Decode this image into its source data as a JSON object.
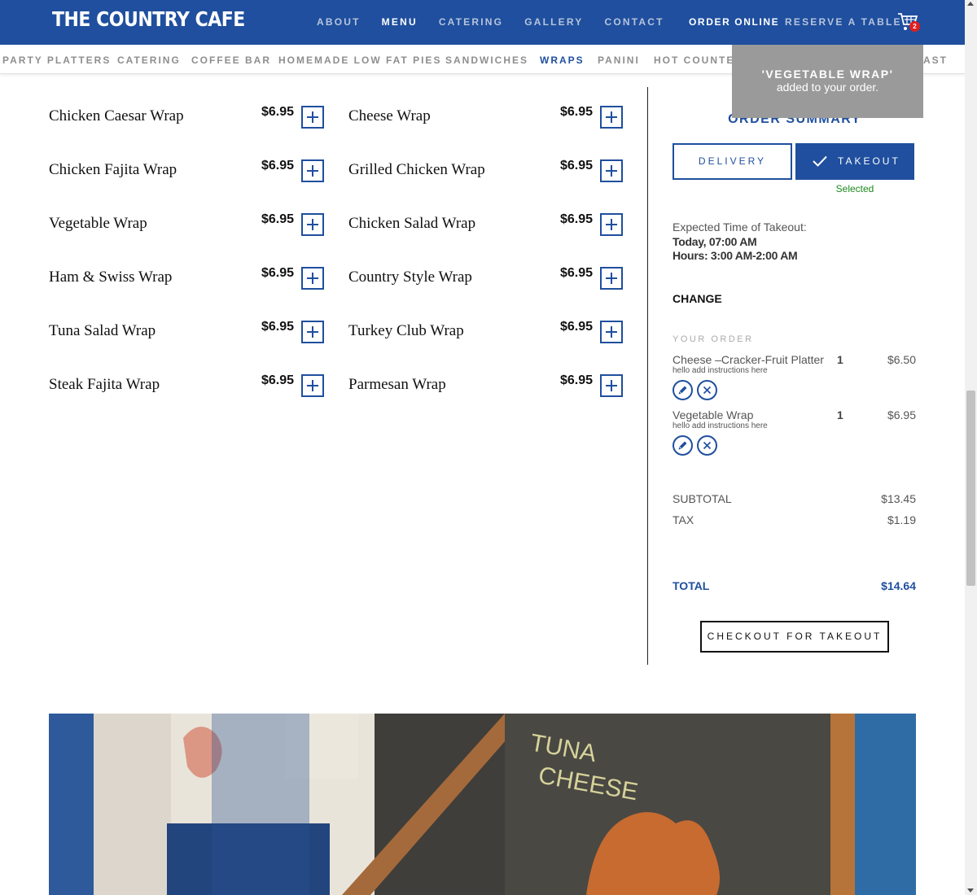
{
  "header": {
    "logo_text": "THE COUNTRY CAFE",
    "nav": [
      "ABOUT",
      "MENU",
      "CATERING",
      "GALLERY",
      "CONTACT"
    ],
    "active_nav": "MENU",
    "order_online": "ORDER ONLINE",
    "reserve": "RESERVE A TABLE",
    "cart_count": "2",
    "brand_color": "#1f4f9e"
  },
  "subnav": {
    "items": [
      "PARTY PLATTERS",
      "CATERING",
      "COFFEE BAR",
      "HOMEMADE LOW FAT PIES",
      "SANDWICHES",
      "WRAPS",
      "PANINI",
      "HOT COUNTER",
      "AST"
    ],
    "active": "WRAPS"
  },
  "menu": {
    "left": [
      {
        "name": "Chicken Caesar Wrap",
        "price": "$6.95"
      },
      {
        "name": "Chicken Fajita Wrap",
        "price": "$6.95"
      },
      {
        "name": "Vegetable Wrap",
        "price": "$6.95"
      },
      {
        "name": "Ham & Swiss Wrap",
        "price": "$6.95"
      },
      {
        "name": "Tuna Salad Wrap",
        "price": "$6.95"
      },
      {
        "name": "Steak Fajita Wrap",
        "price": "$6.95"
      }
    ],
    "right": [
      {
        "name": "Cheese Wrap",
        "price": "$6.95"
      },
      {
        "name": "Grilled Chicken Wrap",
        "price": "$6.95"
      },
      {
        "name": "Chicken Salad Wrap",
        "price": "$6.95"
      },
      {
        "name": "Country Style Wrap",
        "price": "$6.95"
      },
      {
        "name": "Turkey Club Wrap",
        "price": "$6.95"
      },
      {
        "name": "Parmesan Wrap",
        "price": "$6.95"
      }
    ]
  },
  "toast": {
    "title": "'VEGETABLE WRAP'",
    "subtitle": "added to your order."
  },
  "summary": {
    "title": "ORDER SUMMARY",
    "delivery": "DELIVERY",
    "takeout": "TAKEOUT",
    "selected": "Selected",
    "expected_label": "Expected Time of Takeout:",
    "expected_time": "Today, 07:00 AM",
    "hours": "Hours: 3:00 AM-2:00 AM",
    "change": "CHANGE",
    "your_order": "YOUR ORDER",
    "lines": [
      {
        "name": "Cheese –Cracker-Fruit Platter",
        "qty": "1",
        "price": "$6.50",
        "note": "hello add instructions here"
      },
      {
        "name": "Vegetable Wrap",
        "qty": "1",
        "price": "$6.95",
        "note": "hello add instructions here"
      }
    ],
    "subtotal_label": "SUBTOTAL",
    "subtotal": "$13.45",
    "tax_label": "TAX",
    "tax": "$1.19",
    "total_label": "TOTAL",
    "total": "$14.64",
    "checkout": "CHECKOUT FOR TAKEOUT"
  }
}
